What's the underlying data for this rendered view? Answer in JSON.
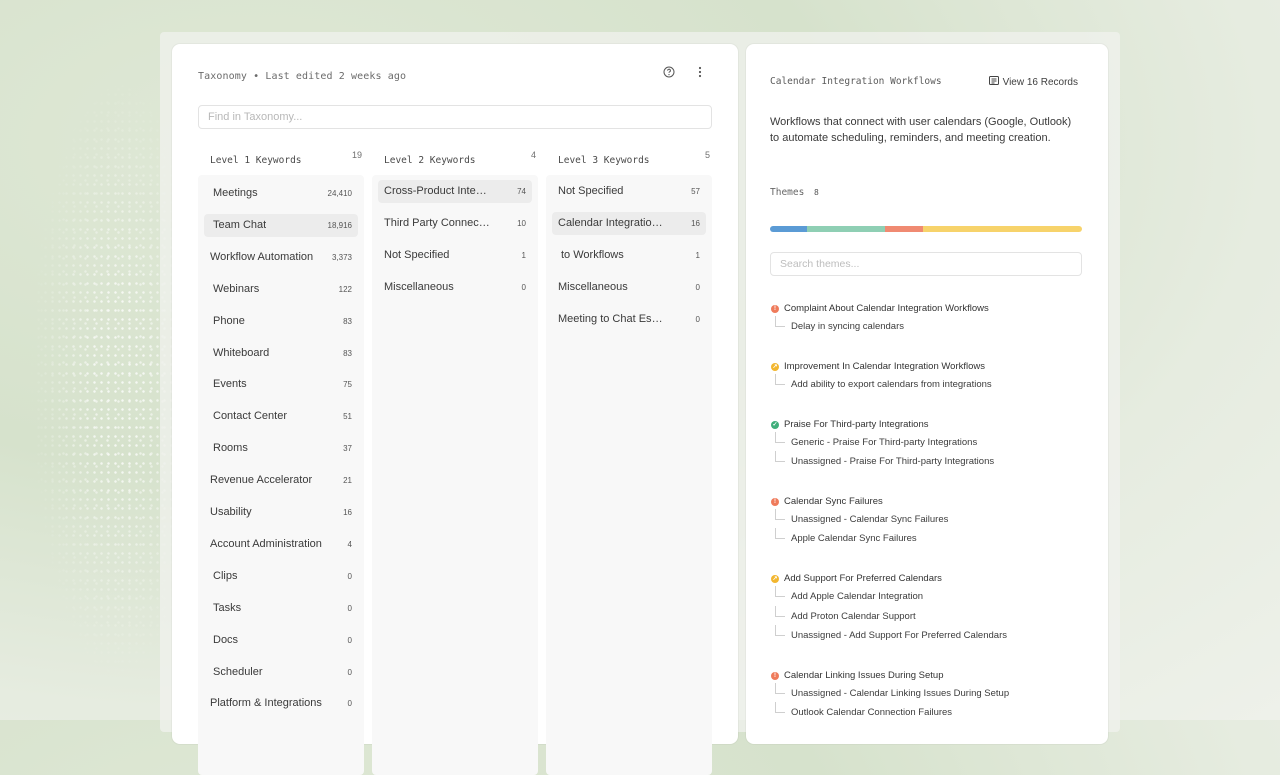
{
  "left": {
    "header_title": "Taxonomy • Last edited 2 weeks ago",
    "help_icon": "help-circle-icon",
    "menu_icon": "more-vertical-icon",
    "search_placeholder": "Find in Taxonomy..."
  },
  "columns": [
    {
      "label": "Level 1 Keywords",
      "count": "19",
      "items": [
        {
          "name": "Meetings",
          "count": "24,410"
        },
        {
          "name": "Team Chat",
          "count": "18,916",
          "selected": true
        },
        {
          "name": "Workflow Automation",
          "count": "3,373"
        },
        {
          "name": "Webinars",
          "count": "122"
        },
        {
          "name": "Phone",
          "count": "83"
        },
        {
          "name": "Whiteboard",
          "count": "83"
        },
        {
          "name": "Events",
          "count": "75"
        },
        {
          "name": "Contact Center",
          "count": "51"
        },
        {
          "name": "Rooms",
          "count": "37"
        },
        {
          "name": "Revenue Accelerator",
          "count": "21"
        },
        {
          "name": "Usability",
          "count": "16"
        },
        {
          "name": "Account Administration",
          "count": "4"
        },
        {
          "name": "Clips",
          "count": "0"
        },
        {
          "name": "Tasks",
          "count": "0"
        },
        {
          "name": "Docs",
          "count": "0"
        },
        {
          "name": "Scheduler",
          "count": "0"
        },
        {
          "name": "Platform & Integrations",
          "count": "0"
        }
      ]
    },
    {
      "label": "Level 2 Keywords",
      "count": "4",
      "items": [
        {
          "name": "Cross-Product Integrations",
          "count": "74",
          "selected": true
        },
        {
          "name": "Third Party Connections",
          "count": "10"
        },
        {
          "name": "Not Specified",
          "count": "1"
        },
        {
          "name": "Miscellaneous",
          "count": "0"
        }
      ]
    },
    {
      "label": "Level 3 Keywords",
      "count": "5",
      "items": [
        {
          "name": "Not Specified",
          "count": "57"
        },
        {
          "name": "Calendar Integration Workflows",
          "count": "16",
          "selected": true
        },
        {
          "name": " to  Workflows",
          "count": "1"
        },
        {
          "name": "Miscellaneous",
          "count": "0"
        },
        {
          "name": "Meeting to Chat Escalation",
          "count": "0"
        }
      ]
    }
  ],
  "right": {
    "title": "Calendar Integration Workflows",
    "view_records": "View 16 Records",
    "view_icon": "records-icon",
    "description": "Workflows that connect  with user calendars (Google, Outlook) to automate scheduling, reminders, and meeting creation.",
    "themes_label": "Themes",
    "themes_count": "8",
    "distribution": [
      {
        "color": "#5b9bd5",
        "share": 0.12
      },
      {
        "color": "#8fcfb4",
        "share": 0.25
      },
      {
        "color": "#f08a72",
        "share": 0.12
      },
      {
        "color": "#f7d36b",
        "share": 0.51
      }
    ],
    "search_placeholder": "Search themes...",
    "themes": [
      {
        "title": "Complaint About Calendar Integration Workflows",
        "status": "complaint",
        "color": "#ef7b5b",
        "subs": [
          "Delay in syncing calendars"
        ]
      },
      {
        "title": "Improvement In Calendar Integration Workflows",
        "status": "improvement",
        "color": "#f2b62f",
        "subs": [
          "Add ability to export calendars from integrations"
        ]
      },
      {
        "title": "Praise For Third-party Integrations",
        "status": "praise",
        "color": "#3fae7a",
        "subs": [
          "Generic - Praise For Third-party Integrations",
          "Unassigned - Praise For Third-party Integrations"
        ]
      },
      {
        "title": "Calendar Sync Failures",
        "status": "complaint",
        "color": "#ef7b5b",
        "subs": [
          "Unassigned - Calendar Sync Failures",
          "Apple Calendar Sync Failures"
        ]
      },
      {
        "title": "Add Support For Preferred Calendars",
        "status": "improvement",
        "color": "#f2b62f",
        "subs": [
          "Add Apple Calendar Integration",
          "Add Proton Calendar Support",
          "Unassigned - Add Support For Preferred Calendars"
        ]
      },
      {
        "title": "Calendar Linking Issues During Setup",
        "status": "complaint",
        "color": "#ef7b5b",
        "subs": [
          "Unassigned - Calendar Linking Issues During Setup",
          "Outlook Calendar Connection Failures"
        ]
      }
    ]
  }
}
